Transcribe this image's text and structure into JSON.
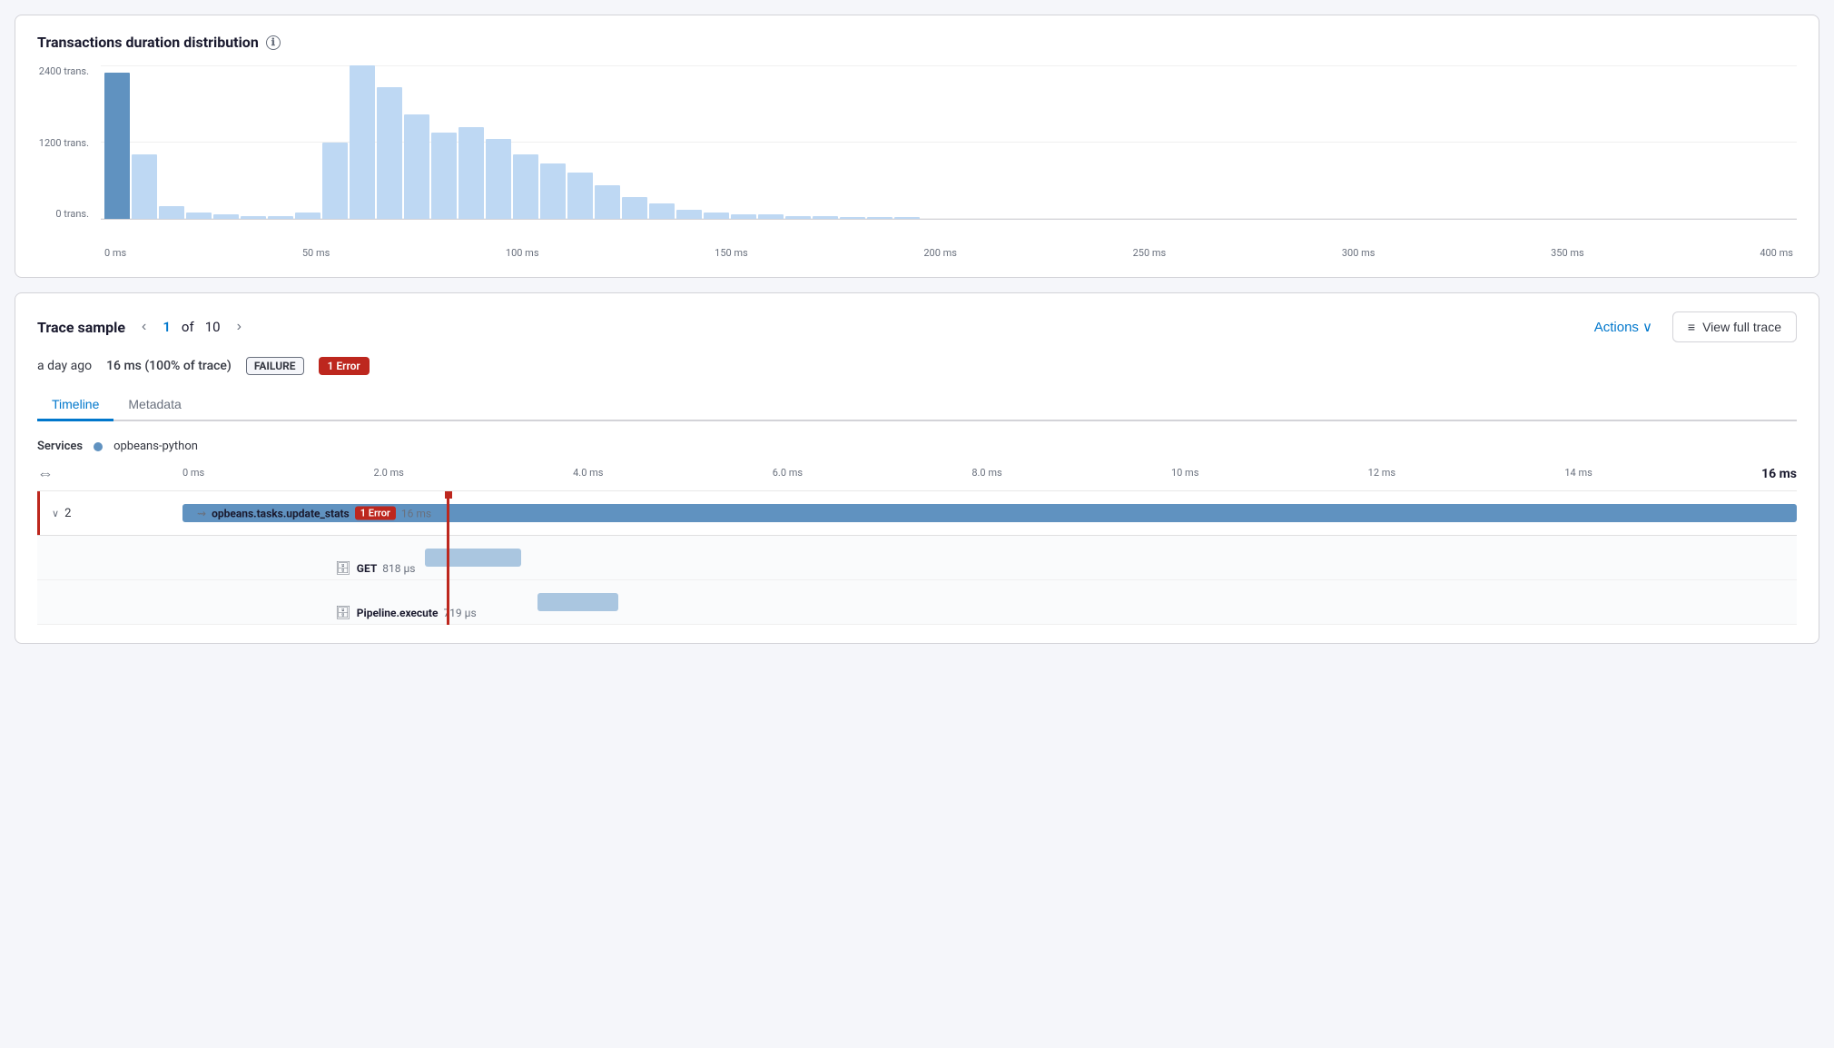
{
  "chart": {
    "title": "Transactions duration distribution",
    "info_icon": "ℹ",
    "y_labels": [
      "2400 trans.",
      "1200 trans.",
      "0 trans."
    ],
    "x_labels": [
      "0 ms",
      "50 ms",
      "100 ms",
      "150 ms",
      "200 ms",
      "250 ms",
      "300 ms",
      "350 ms",
      "400 ms"
    ],
    "bars": [
      {
        "selected": true,
        "height_pct": 95
      },
      {
        "selected": false,
        "height_pct": 42
      },
      {
        "selected": false,
        "height_pct": 8
      },
      {
        "selected": false,
        "height_pct": 4
      },
      {
        "selected": false,
        "height_pct": 3
      },
      {
        "selected": false,
        "height_pct": 2
      },
      {
        "selected": false,
        "height_pct": 2
      },
      {
        "selected": false,
        "height_pct": 4
      },
      {
        "selected": false,
        "height_pct": 50
      },
      {
        "selected": false,
        "height_pct": 100
      },
      {
        "selected": false,
        "height_pct": 86
      },
      {
        "selected": false,
        "height_pct": 68
      },
      {
        "selected": false,
        "height_pct": 56
      },
      {
        "selected": false,
        "height_pct": 60
      },
      {
        "selected": false,
        "height_pct": 52
      },
      {
        "selected": false,
        "height_pct": 42
      },
      {
        "selected": false,
        "height_pct": 36
      },
      {
        "selected": false,
        "height_pct": 30
      },
      {
        "selected": false,
        "height_pct": 22
      },
      {
        "selected": false,
        "height_pct": 14
      },
      {
        "selected": false,
        "height_pct": 10
      },
      {
        "selected": false,
        "height_pct": 6
      },
      {
        "selected": false,
        "height_pct": 4
      },
      {
        "selected": false,
        "height_pct": 3
      },
      {
        "selected": false,
        "height_pct": 3
      },
      {
        "selected": false,
        "height_pct": 2
      },
      {
        "selected": false,
        "height_pct": 2
      },
      {
        "selected": false,
        "height_pct": 1
      },
      {
        "selected": false,
        "height_pct": 1
      },
      {
        "selected": false,
        "height_pct": 1
      }
    ]
  },
  "trace": {
    "title": "Trace sample",
    "current_page": "1",
    "of_label": "of",
    "total_pages": "10",
    "prev_arrow": "‹",
    "next_arrow": "›",
    "actions_label": "Actions",
    "actions_chevron": "∨",
    "view_full_trace_label": "View full trace",
    "view_full_trace_icon": "≡",
    "time_ago": "a day ago",
    "duration": "16 ms (100% of trace)",
    "failure_badge": "FAILURE",
    "error_badge": "1 Error",
    "tabs": [
      "Timeline",
      "Metadata"
    ],
    "active_tab": "Timeline",
    "services_label": "Services",
    "service_name": "opbeans-python",
    "timeline": {
      "ticks": [
        "0 ms",
        "2.0 ms",
        "4.0 ms",
        "6.0 ms",
        "8.0 ms",
        "10 ms",
        "12 ms",
        "14 ms"
      ],
      "end_tick": "16 ms",
      "marker_position_pct": 15,
      "rows": [
        {
          "type": "parent",
          "count": "2",
          "has_error": true,
          "bar_left_pct": 0,
          "bar_width_pct": 100,
          "name": "opbeans.tasks.update_stats",
          "error_label": "1 Error",
          "duration": "16 ms",
          "span_type_icon": "⇝",
          "is_span_label_inside": true
        },
        {
          "type": "child",
          "has_error": false,
          "bar_left_pct": 15,
          "bar_width_pct": 6,
          "name": "GET",
          "duration": "818 µs",
          "db_icon": "🗄",
          "is_span_label_inside": false
        },
        {
          "type": "child",
          "has_error": false,
          "bar_left_pct": 22,
          "bar_width_pct": 5,
          "name": "Pipeline.execute",
          "duration": "719 µs",
          "db_icon": "🗄",
          "is_span_label_inside": false
        }
      ]
    }
  }
}
